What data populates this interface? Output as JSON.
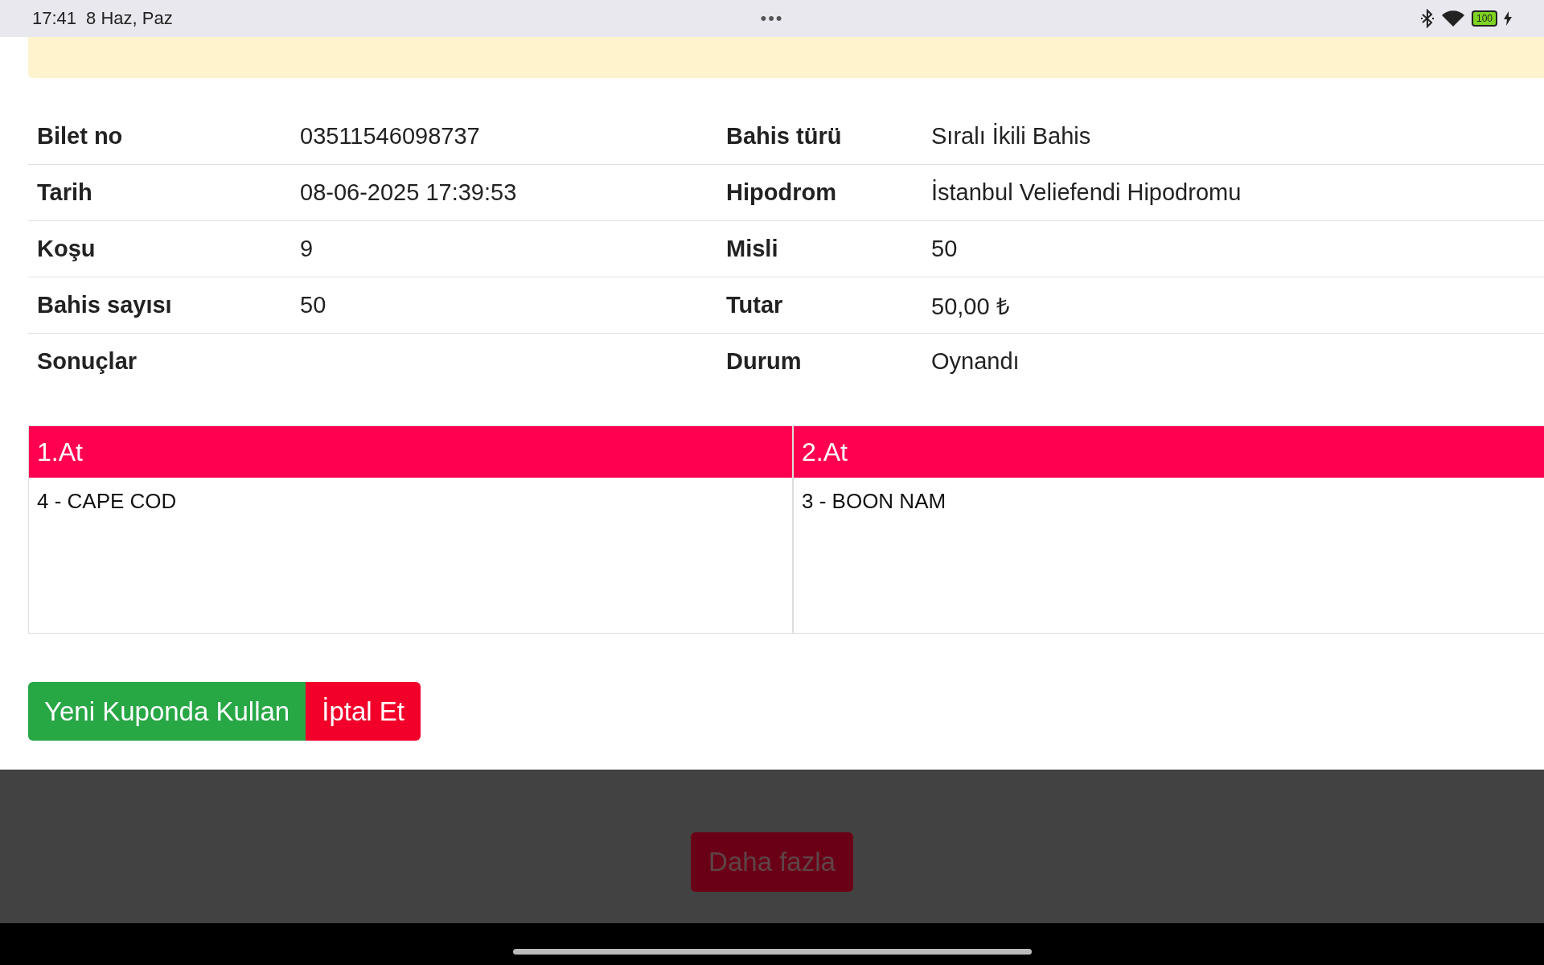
{
  "status_bar": {
    "time": "17:41",
    "date": "8 Haz, Paz",
    "more": "•••",
    "battery": "100"
  },
  "details": [
    {
      "label": "Bilet no",
      "value": "03511546098737",
      "label2": "Bahis türü",
      "value2": "Sıralı İkili Bahis"
    },
    {
      "label": "Tarih",
      "value": "08-06-2025 17:39:53",
      "label2": "Hipodrom",
      "value2": "İstanbul Veliefendi Hipodromu"
    },
    {
      "label": "Koşu",
      "value": "9",
      "label2": "Misli",
      "value2": "50"
    },
    {
      "label": "Bahis sayısı",
      "value": "50",
      "label2": "Tutar",
      "value2": "50,00 ₺"
    },
    {
      "label": "Sonuçlar",
      "label2": "Durum",
      "value2": "Oynandı"
    }
  ],
  "horses": [
    {
      "header": "1.At",
      "entries": [
        "4 - CAPE COD"
      ]
    },
    {
      "header": "2.At",
      "entries": [
        "3 - BOON NAM"
      ]
    }
  ],
  "buttons": [
    {
      "label": "Yeni Kuponda Kullan",
      "kind": "success"
    },
    {
      "label": "İptal Et",
      "kind": "danger"
    }
  ],
  "background": {
    "more_button": "Daha fazla"
  }
}
